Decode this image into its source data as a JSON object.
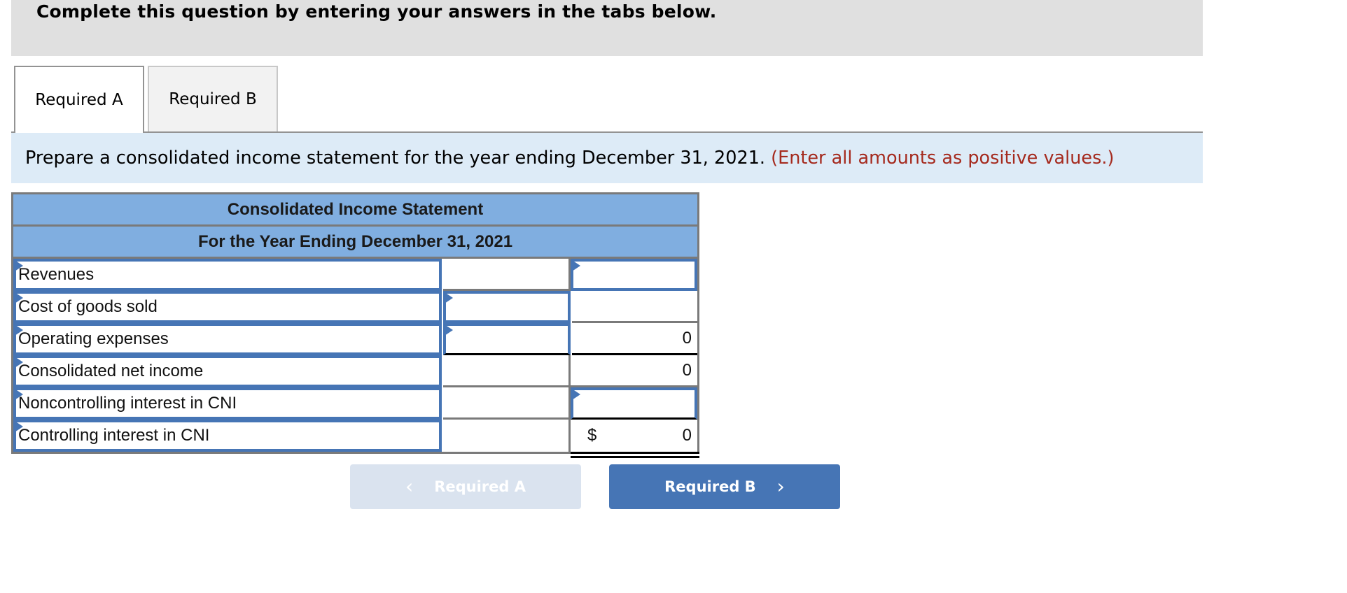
{
  "banner": {
    "title": "Complete this question by entering your answers in the tabs below."
  },
  "tabs": [
    {
      "label": "Required A",
      "active": true
    },
    {
      "label": "Required B",
      "active": false
    }
  ],
  "instructions": {
    "text": "Prepare a consolidated income statement for the year ending December 31, 2021.",
    "note": "(Enter all amounts as positive values.)"
  },
  "statement": {
    "title": "Consolidated Income Statement",
    "period": "For the Year Ending December 31, 2021",
    "rows": [
      {
        "label": "Revenues",
        "mid": "",
        "right": "",
        "currency": ""
      },
      {
        "label": "Cost of goods sold",
        "mid": "",
        "right": "",
        "currency": ""
      },
      {
        "label": "Operating expenses",
        "mid": "",
        "right": "0",
        "currency": ""
      },
      {
        "label": "Consolidated net income",
        "mid": "",
        "right": "0",
        "currency": ""
      },
      {
        "label": "Noncontrolling interest in CNI",
        "mid": "",
        "right": "",
        "currency": ""
      },
      {
        "label": "Controlling interest in CNI",
        "mid": "",
        "right": "0",
        "currency": "$"
      }
    ]
  },
  "navigation": {
    "prev_label": "Required A",
    "prev_icon": "chevron-left-icon",
    "prev_enabled": false,
    "next_label": "Required B",
    "next_icon": "chevron-right-icon",
    "next_enabled": true
  },
  "colors": {
    "accent": "#4675b5",
    "header_fill": "#80aee0",
    "instructions_fill": "#ddebf7",
    "note_red": "#a52a1e",
    "banner_gray": "#e0e0e0"
  }
}
